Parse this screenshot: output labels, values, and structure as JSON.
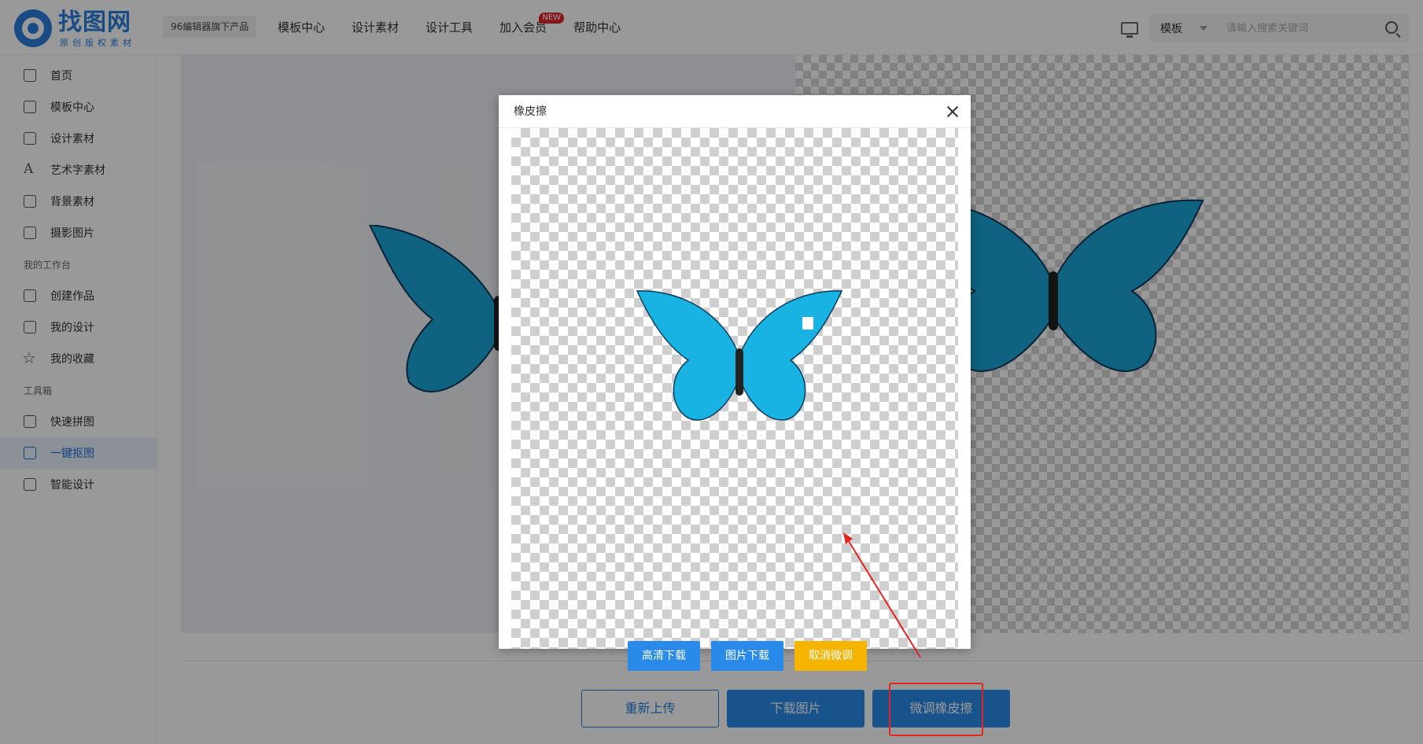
{
  "header": {
    "logo_name": "找图网",
    "logo_sub": "原创版权素材",
    "product_badge": "96编辑器旗下产品",
    "nav": [
      "模板中心",
      "设计素材",
      "设计工具",
      "加入会员",
      "帮助中心"
    ],
    "nav_new_badge": "NEW",
    "search_type": "模板",
    "search_placeholder": "请输入搜索关键词"
  },
  "sidebar": {
    "items": [
      {
        "label": "首页",
        "icon": "home-icon"
      },
      {
        "label": "模板中心",
        "icon": "template-icon"
      },
      {
        "label": "设计素材",
        "icon": "material-icon"
      },
      {
        "label": "艺术字素材",
        "icon": "art-text-icon"
      },
      {
        "label": "背景素材",
        "icon": "background-icon"
      },
      {
        "label": "摄影图片",
        "icon": "photo-icon"
      }
    ],
    "group_workspace": "我的工作台",
    "workspace_items": [
      {
        "label": "创建作品",
        "icon": "create-icon"
      },
      {
        "label": "我的设计",
        "icon": "design-icon"
      },
      {
        "label": "我的收藏",
        "icon": "star-icon"
      }
    ],
    "group_toolbox": "工具箱",
    "toolbox_items": [
      {
        "label": "快速拼图",
        "icon": "collage-icon"
      },
      {
        "label": "一键抠图",
        "icon": "cutout-icon",
        "active": true
      },
      {
        "label": "智能设计",
        "icon": "smart-design-icon"
      }
    ]
  },
  "main": {
    "buttons": {
      "reupload": "重新上传",
      "download": "下载图片",
      "eraser": "微调橡皮擦"
    }
  },
  "modal": {
    "title": "橡皮擦",
    "btn_hd_download": "高清下载",
    "btn_img_download": "图片下载",
    "btn_cancel": "取消微调"
  },
  "colors": {
    "brand": "#2b7fde",
    "primary_button": "#2a8ae9",
    "cancel_button": "#f5b400",
    "annotation": "#e32521",
    "butterfly": "#1aa6d6"
  }
}
